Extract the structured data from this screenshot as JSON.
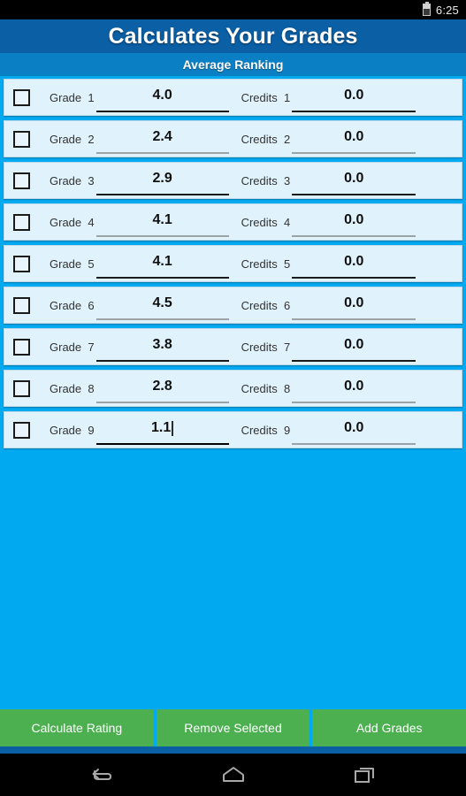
{
  "status_bar": {
    "clock": "6:25",
    "battery_icon": "battery-icon"
  },
  "header": {
    "title": "Calculates Your Grades",
    "subtitle": "Average Ranking"
  },
  "grade_list": {
    "grade_label_prefix": "Grade",
    "credits_label_prefix": "Credits",
    "rows": [
      {
        "index": "1",
        "grade_label": "Grade  1",
        "grade_value": "4.0",
        "credits_label": "Credits  1",
        "credits_value": "0.0",
        "checked": false,
        "grade_underline": "dark",
        "credits_underline": "dark",
        "focused": false
      },
      {
        "index": "2",
        "grade_label": "Grade  2",
        "grade_value": "2.4",
        "credits_label": "Credits  2",
        "credits_value": "0.0",
        "checked": false,
        "grade_underline": "gray",
        "credits_underline": "gray",
        "focused": false
      },
      {
        "index": "3",
        "grade_label": "Grade  3",
        "grade_value": "2.9",
        "credits_label": "Credits  3",
        "credits_value": "0.0",
        "checked": false,
        "grade_underline": "dark",
        "credits_underline": "dark",
        "focused": false
      },
      {
        "index": "4",
        "grade_label": "Grade  4",
        "grade_value": "4.1",
        "credits_label": "Credits  4",
        "credits_value": "0.0",
        "checked": false,
        "grade_underline": "gray",
        "credits_underline": "gray",
        "focused": false
      },
      {
        "index": "5",
        "grade_label": "Grade  5",
        "grade_value": "4.1",
        "credits_label": "Credits  5",
        "credits_value": "0.0",
        "checked": false,
        "grade_underline": "dark",
        "credits_underline": "dark",
        "focused": false
      },
      {
        "index": "6",
        "grade_label": "Grade  6",
        "grade_value": "4.5",
        "credits_label": "Credits  6",
        "credits_value": "0.0",
        "checked": false,
        "grade_underline": "gray",
        "credits_underline": "gray",
        "focused": false
      },
      {
        "index": "7",
        "grade_label": "Grade  7",
        "grade_value": "3.8",
        "credits_label": "Credits  7",
        "credits_value": "0.0",
        "checked": false,
        "grade_underline": "dark",
        "credits_underline": "dark",
        "focused": false
      },
      {
        "index": "8",
        "grade_label": "Grade  8",
        "grade_value": "2.8",
        "credits_label": "Credits  8",
        "credits_value": "0.0",
        "checked": false,
        "grade_underline": "gray",
        "credits_underline": "gray",
        "focused": false
      },
      {
        "index": "9",
        "grade_label": "Grade  9",
        "grade_value": "1.1",
        "credits_label": "Credits  9",
        "credits_value": "0.0",
        "checked": false,
        "grade_underline": "focus",
        "credits_underline": "gray",
        "focused": true
      }
    ]
  },
  "actions": {
    "calculate_label": "Calculate Rating",
    "remove_label": "Remove Selected",
    "add_label": "Add Grades"
  },
  "nav_bar": {
    "back_icon": "back-icon",
    "home_icon": "home-icon",
    "recents_icon": "recents-icon"
  },
  "colors": {
    "background": "#00A9F0",
    "title_bar": "#0B5FA5",
    "subtitle_bar": "#0B7FC4",
    "row_background": "#E0F2FB",
    "action_green": "#4CAF50",
    "status_bar": "#000000"
  }
}
